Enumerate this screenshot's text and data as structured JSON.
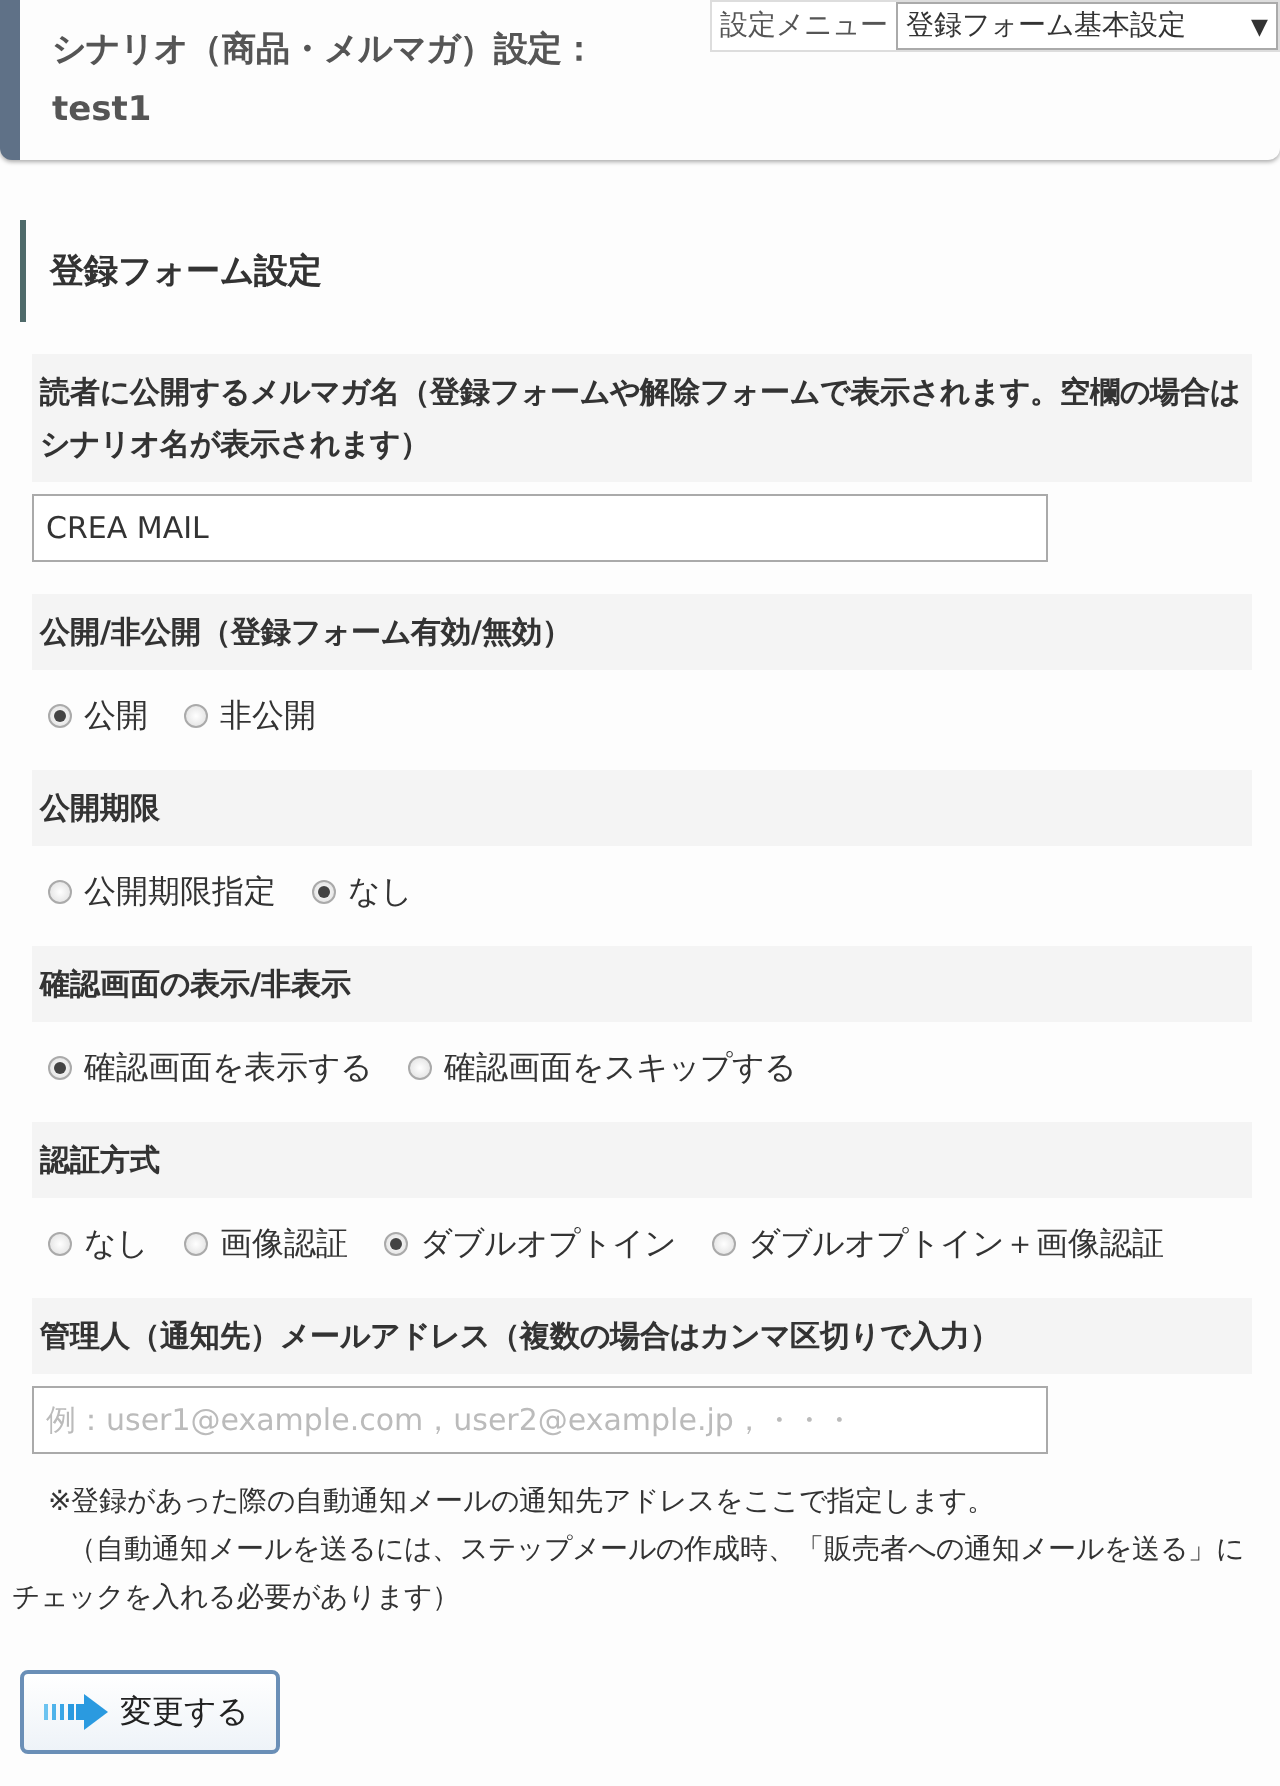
{
  "header": {
    "title": "シナリオ（商品・メルマガ）設定：",
    "name": "test1"
  },
  "settings_menu": {
    "label": "設定メニュー",
    "value": "登録フォーム基本設定",
    "caret": "▼"
  },
  "section": {
    "title": "登録フォーム設定"
  },
  "fields": [
    {
      "kind": "text",
      "label": "読者に公開するメルマガ名（登録フォームや解除フォームで表示されます。空欄の場合はシナリオ名が表示されます）",
      "value": "CREA MAIL"
    },
    {
      "kind": "radio",
      "label": "公開/非公開（登録フォーム有効/無効）",
      "options": [
        {
          "label": "公開",
          "selected": true
        },
        {
          "label": "非公開",
          "selected": false
        }
      ]
    },
    {
      "kind": "radio",
      "label": "公開期限",
      "options": [
        {
          "label": "公開期限指定",
          "selected": false
        },
        {
          "label": "なし",
          "selected": true
        }
      ]
    },
    {
      "kind": "radio",
      "label": "確認画面の表示/非表示",
      "options": [
        {
          "label": "確認画面を表示する",
          "selected": true
        },
        {
          "label": "確認画面をスキップする",
          "selected": false
        }
      ]
    },
    {
      "kind": "radio",
      "label": "認証方式",
      "options": [
        {
          "label": "なし",
          "selected": false
        },
        {
          "label": "画像認証",
          "selected": false
        },
        {
          "label": "ダブルオプトイン",
          "selected": true
        },
        {
          "label": "ダブルオプトイン＋画像認証",
          "selected": false
        }
      ]
    },
    {
      "kind": "text",
      "label": "管理人（通知先）メールアドレス（複数の場合はカンマ区切りで入力）",
      "placeholder": "例：user1@example.com，user2@example.jp，・・・",
      "notes": [
        "※登録があった際の自動通知メールの通知先アドレスをここで指定します。",
        "（自動通知メールを送るには、ステップメールの作成時、「販売者への通知メールを送る」にチェックを入れる必要があります）"
      ]
    }
  ],
  "submit": {
    "label": "変更する"
  }
}
